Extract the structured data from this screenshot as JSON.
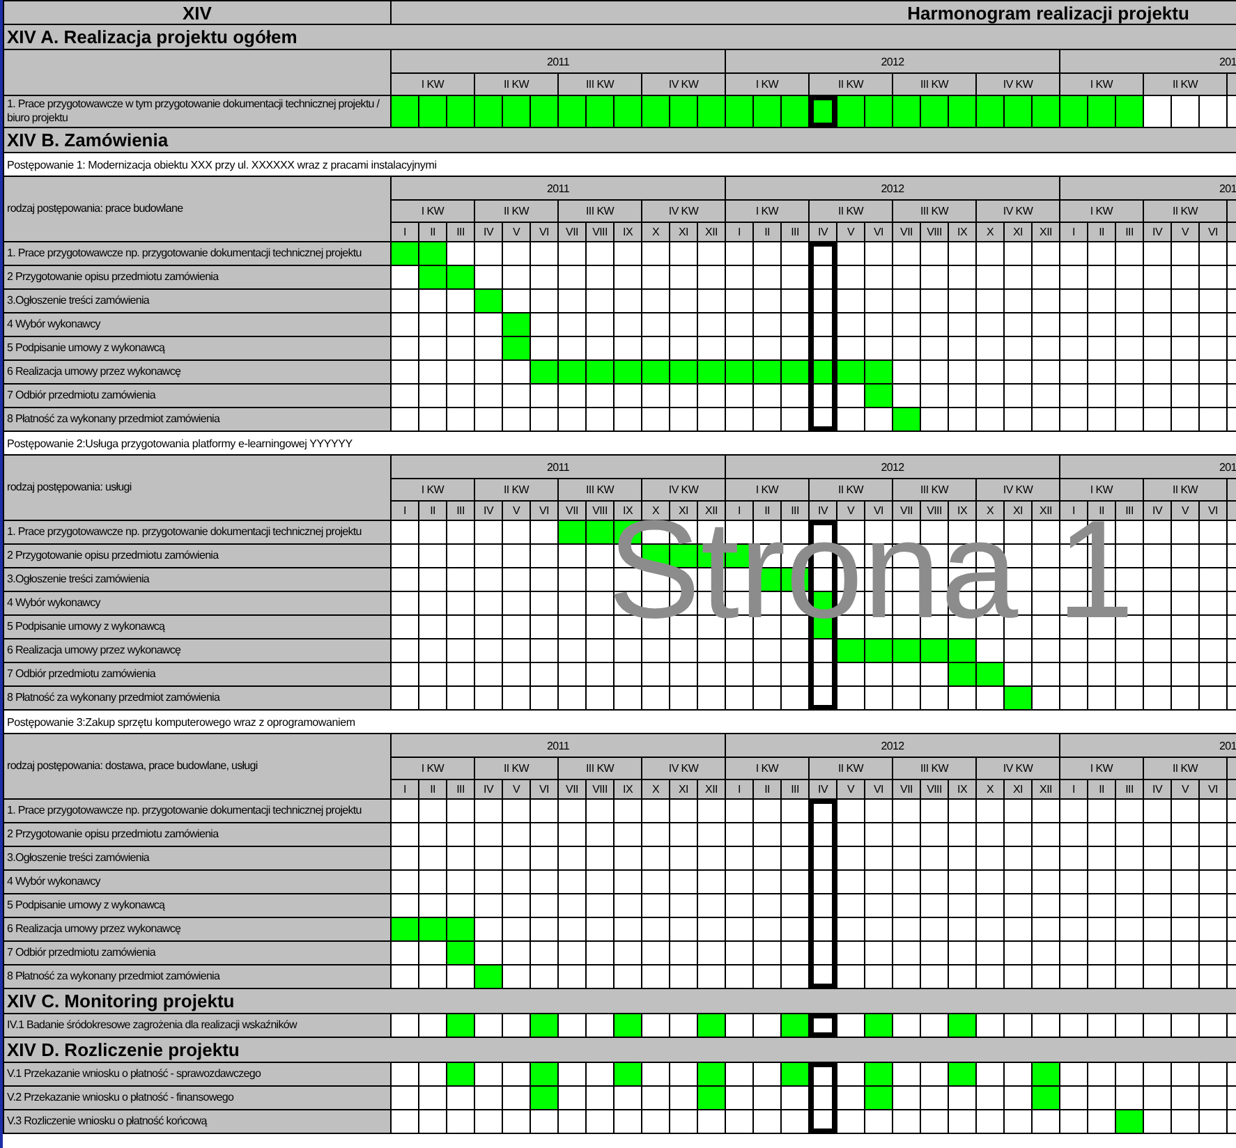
{
  "title_row": {
    "left": "XIV",
    "right": "Harmonogram realizacji projektu"
  },
  "sections": [
    {
      "kind": "overall",
      "title": "XIV A. Realizacja projektu ogółem",
      "timeline": [
        {
          "year": "2011",
          "quarters": [
            {
              "label": "I KW"
            },
            {
              "label": "II KW"
            },
            {
              "label": "III KW"
            },
            {
              "label": "IV KW"
            }
          ]
        },
        {
          "year": "2012",
          "quarters": [
            {
              "label": "I KW"
            },
            {
              "label": "II KW"
            },
            {
              "label": "III KW"
            },
            {
              "label": "IV KW"
            }
          ]
        },
        {
          "year": "201",
          "quarters": [
            {
              "label": "I KW"
            },
            {
              "label": "II KW"
            }
          ]
        }
      ],
      "marked": [
        false,
        false,
        false,
        false,
        false,
        false,
        false,
        false,
        false,
        false,
        false,
        false,
        false,
        false,
        false,
        true,
        false,
        false,
        false,
        false,
        false,
        false,
        false,
        false,
        false,
        false,
        false,
        false,
        false,
        false
      ],
      "rows": [
        {
          "label": "1. Prace przygotowawcze w tym przygotowanie dokumentacji technicznej projektu / biuro projektu",
          "filled": [
            true,
            true,
            true,
            true,
            true,
            true,
            true,
            true,
            true,
            true,
            true,
            true,
            true,
            true,
            true,
            true,
            true,
            true,
            true,
            true,
            true,
            true,
            true,
            true,
            true,
            true,
            true,
            false,
            false,
            false
          ]
        }
      ]
    },
    {
      "kind": "orders",
      "title": "XIV B. Zamówienia",
      "procedures": [
        {
          "name": "Postępowanie 1: Modernizacja obiektu XXX przy ul. XXXXXX wraz z pracami instalacyjnymi",
          "type": "rodzaj postępowania: prace budowlane",
          "timeline": [
            {
              "year": "2011",
              "quarters": [
                {
                  "label": "I KW",
                  "months": [
                    "I",
                    "II",
                    "III"
                  ]
                },
                {
                  "label": "II KW",
                  "months": [
                    "IV",
                    "V",
                    "VI"
                  ]
                },
                {
                  "label": "III KW",
                  "months": [
                    "VII",
                    "VIII",
                    "IX"
                  ]
                },
                {
                  "label": "IV KW",
                  "months": [
                    "X",
                    "XI",
                    "XII"
                  ]
                }
              ]
            },
            {
              "year": "2012",
              "quarters": [
                {
                  "label": "I KW",
                  "months": [
                    "I",
                    "II",
                    "III"
                  ]
                },
                {
                  "label": "II KW",
                  "months": [
                    "IV",
                    "V",
                    "VI"
                  ]
                },
                {
                  "label": "III KW",
                  "months": [
                    "VII",
                    "VIII",
                    "IX"
                  ]
                },
                {
                  "label": "IV KW",
                  "months": [
                    "X",
                    "XI",
                    "XII"
                  ]
                }
              ]
            },
            {
              "year": "201",
              "quarters": [
                {
                  "label": "I KW",
                  "months": [
                    "I",
                    "II",
                    "III"
                  ]
                },
                {
                  "label": "II KW",
                  "months": [
                    "IV",
                    "V",
                    "VI"
                  ]
                }
              ]
            }
          ],
          "marked": [
            false,
            false,
            false,
            false,
            false,
            false,
            false,
            false,
            false,
            false,
            false,
            false,
            false,
            false,
            false,
            true,
            false,
            false,
            false,
            false,
            false,
            false,
            false,
            false,
            false,
            false,
            false,
            false,
            false,
            false
          ],
          "rows": [
            {
              "label": "1. Prace przygotowawcze np. przygotowanie dokumentacji technicznej projektu",
              "filled": [
                true,
                true,
                false,
                false,
                false,
                false,
                false,
                false,
                false,
                false,
                false,
                false,
                false,
                false,
                false,
                false,
                false,
                false,
                false,
                false,
                false,
                false,
                false,
                false,
                false,
                false,
                false,
                false,
                false,
                false
              ]
            },
            {
              "label": "2 Przygotowanie opisu przedmiotu zamówienia",
              "filled": [
                false,
                true,
                true,
                false,
                false,
                false,
                false,
                false,
                false,
                false,
                false,
                false,
                false,
                false,
                false,
                false,
                false,
                false,
                false,
                false,
                false,
                false,
                false,
                false,
                false,
                false,
                false,
                false,
                false,
                false
              ]
            },
            {
              "label": "3.Ogłoszenie treści zamówienia",
              "filled": [
                false,
                false,
                false,
                true,
                false,
                false,
                false,
                false,
                false,
                false,
                false,
                false,
                false,
                false,
                false,
                false,
                false,
                false,
                false,
                false,
                false,
                false,
                false,
                false,
                false,
                false,
                false,
                false,
                false,
                false
              ]
            },
            {
              "label": "4 Wybór wykonawcy",
              "filled": [
                false,
                false,
                false,
                false,
                true,
                false,
                false,
                false,
                false,
                false,
                false,
                false,
                false,
                false,
                false,
                false,
                false,
                false,
                false,
                false,
                false,
                false,
                false,
                false,
                false,
                false,
                false,
                false,
                false,
                false
              ]
            },
            {
              "label": "5 Podpisanie umowy z wykonawcą",
              "filled": [
                false,
                false,
                false,
                false,
                true,
                false,
                false,
                false,
                false,
                false,
                false,
                false,
                false,
                false,
                false,
                false,
                false,
                false,
                false,
                false,
                false,
                false,
                false,
                false,
                false,
                false,
                false,
                false,
                false,
                false
              ]
            },
            {
              "label": "6 Realizacja umowy przez wykonawcę",
              "filled": [
                false,
                false,
                false,
                false,
                false,
                true,
                true,
                true,
                true,
                true,
                true,
                true,
                true,
                true,
                true,
                true,
                true,
                true,
                false,
                false,
                false,
                false,
                false,
                false,
                false,
                false,
                false,
                false,
                false,
                false
              ]
            },
            {
              "label": "7 Odbiór przedmiotu zamówienia",
              "filled": [
                false,
                false,
                false,
                false,
                false,
                false,
                false,
                false,
                false,
                false,
                false,
                false,
                false,
                false,
                false,
                false,
                false,
                true,
                false,
                false,
                false,
                false,
                false,
                false,
                false,
                false,
                false,
                false,
                false,
                false
              ]
            },
            {
              "label": "8 Płatność za wykonany przedmiot zamówienia",
              "filled": [
                false,
                false,
                false,
                false,
                false,
                false,
                false,
                false,
                false,
                false,
                false,
                false,
                false,
                false,
                false,
                false,
                false,
                false,
                true,
                false,
                false,
                false,
                false,
                false,
                false,
                false,
                false,
                false,
                false,
                false
              ]
            }
          ]
        },
        {
          "name": "Postępowanie 2:Usługa przygotowania platformy e-learningowej YYYYYY",
          "type": "rodzaj postępowania: usługi",
          "timeline": [
            {
              "year": "2011",
              "quarters": [
                {
                  "label": "I KW",
                  "months": [
                    "I",
                    "II",
                    "III"
                  ]
                },
                {
                  "label": "II KW",
                  "months": [
                    "IV",
                    "V",
                    "VI"
                  ]
                },
                {
                  "label": "III KW",
                  "months": [
                    "VII",
                    "VIII",
                    "IX"
                  ]
                },
                {
                  "label": "IV KW",
                  "months": [
                    "X",
                    "XI",
                    "XII"
                  ]
                }
              ]
            },
            {
              "year": "2012",
              "quarters": [
                {
                  "label": "I KW",
                  "months": [
                    "I",
                    "II",
                    "III"
                  ]
                },
                {
                  "label": "II KW",
                  "months": [
                    "IV",
                    "V",
                    "VI"
                  ]
                },
                {
                  "label": "III KW",
                  "months": [
                    "VII",
                    "VIII",
                    "IX"
                  ]
                },
                {
                  "label": "IV KW",
                  "months": [
                    "X",
                    "XI",
                    "XII"
                  ]
                }
              ]
            },
            {
              "year": "201",
              "quarters": [
                {
                  "label": "I KW",
                  "months": [
                    "I",
                    "II",
                    "III"
                  ]
                },
                {
                  "label": "II KW",
                  "months": [
                    "IV",
                    "V",
                    "VI"
                  ]
                }
              ]
            }
          ],
          "marked": [
            false,
            false,
            false,
            false,
            false,
            false,
            false,
            false,
            false,
            false,
            false,
            false,
            false,
            false,
            false,
            true,
            false,
            false,
            false,
            false,
            false,
            false,
            false,
            false,
            false,
            false,
            false,
            false,
            false,
            false
          ],
          "rows": [
            {
              "label": "1. Prace przygotowawcze np. przygotowanie dokumentacji technicznej projektu",
              "filled": [
                false,
                false,
                false,
                false,
                false,
                false,
                true,
                true,
                true,
                false,
                false,
                false,
                false,
                false,
                false,
                false,
                false,
                false,
                false,
                false,
                false,
                false,
                false,
                false,
                false,
                false,
                false,
                false,
                false,
                false
              ]
            },
            {
              "label": "2 Przygotowanie opisu przedmiotu zamówienia",
              "filled": [
                false,
                false,
                false,
                false,
                false,
                false,
                false,
                false,
                false,
                true,
                true,
                true,
                true,
                false,
                false,
                false,
                false,
                false,
                false,
                false,
                false,
                false,
                false,
                false,
                false,
                false,
                false,
                false,
                false,
                false
              ]
            },
            {
              "label": "3.Ogłoszenie treści zamówienia",
              "filled": [
                false,
                false,
                false,
                false,
                false,
                false,
                false,
                false,
                false,
                false,
                false,
                false,
                false,
                true,
                true,
                false,
                false,
                false,
                false,
                false,
                false,
                false,
                false,
                false,
                false,
                false,
                false,
                false,
                false,
                false
              ]
            },
            {
              "label": "4 Wybór wykonawcy",
              "filled": [
                false,
                false,
                false,
                false,
                false,
                false,
                false,
                false,
                false,
                false,
                false,
                false,
                false,
                false,
                false,
                true,
                false,
                false,
                false,
                false,
                false,
                false,
                false,
                false,
                false,
                false,
                false,
                false,
                false,
                false
              ]
            },
            {
              "label": "5 Podpisanie umowy z wykonawcą",
              "filled": [
                false,
                false,
                false,
                false,
                false,
                false,
                false,
                false,
                false,
                false,
                false,
                false,
                false,
                false,
                false,
                true,
                false,
                false,
                false,
                false,
                false,
                false,
                false,
                false,
                false,
                false,
                false,
                false,
                false,
                false
              ]
            },
            {
              "label": "6 Realizacja umowy przez wykonawcę",
              "filled": [
                false,
                false,
                false,
                false,
                false,
                false,
                false,
                false,
                false,
                false,
                false,
                false,
                false,
                false,
                false,
                false,
                true,
                true,
                true,
                true,
                true,
                false,
                false,
                false,
                false,
                false,
                false,
                false,
                false,
                false
              ]
            },
            {
              "label": "7 Odbiór przedmiotu zamówienia",
              "filled": [
                false,
                false,
                false,
                false,
                false,
                false,
                false,
                false,
                false,
                false,
                false,
                false,
                false,
                false,
                false,
                false,
                false,
                false,
                false,
                false,
                true,
                true,
                false,
                false,
                false,
                false,
                false,
                false,
                false,
                false
              ]
            },
            {
              "label": "8 Płatność za wykonany przedmiot zamówienia",
              "filled": [
                false,
                false,
                false,
                false,
                false,
                false,
                false,
                false,
                false,
                false,
                false,
                false,
                false,
                false,
                false,
                false,
                false,
                false,
                false,
                false,
                false,
                false,
                true,
                false,
                false,
                false,
                false,
                false,
                false,
                false
              ]
            }
          ]
        },
        {
          "name": "Postępowanie 3:Zakup sprzętu komputerowego wraz z oprogramowaniem",
          "type": "rodzaj postępowania: dostawa, prace budowlane, usługi",
          "timeline": [
            {
              "year": "2011",
              "quarters": [
                {
                  "label": "I KW",
                  "months": [
                    "I",
                    "II",
                    "III"
                  ]
                },
                {
                  "label": "II KW",
                  "months": [
                    "IV",
                    "V",
                    "VI"
                  ]
                },
                {
                  "label": "III KW",
                  "months": [
                    "VII",
                    "VIII",
                    "IX"
                  ]
                },
                {
                  "label": "IV KW",
                  "months": [
                    "X",
                    "XI",
                    "XII"
                  ]
                }
              ]
            },
            {
              "year": "2012",
              "quarters": [
                {
                  "label": "I KW",
                  "months": [
                    "I",
                    "II",
                    "III"
                  ]
                },
                {
                  "label": "II KW",
                  "months": [
                    "IV",
                    "V",
                    "VI"
                  ]
                },
                {
                  "label": "III KW",
                  "months": [
                    "VII",
                    "VIII",
                    "IX"
                  ]
                },
                {
                  "label": "IV KW",
                  "months": [
                    "X",
                    "XI",
                    "XII"
                  ]
                }
              ]
            },
            {
              "year": "201",
              "quarters": [
                {
                  "label": "I KW",
                  "months": [
                    "I",
                    "II",
                    "III"
                  ]
                },
                {
                  "label": "II KW",
                  "months": [
                    "IV",
                    "V",
                    "VI"
                  ]
                }
              ]
            }
          ],
          "marked": [
            false,
            false,
            false,
            false,
            false,
            false,
            false,
            false,
            false,
            false,
            false,
            false,
            false,
            false,
            false,
            true,
            false,
            false,
            false,
            false,
            false,
            false,
            false,
            false,
            false,
            false,
            false,
            false,
            false,
            false
          ],
          "rows": [
            {
              "label": "1. Prace przygotowawcze np. przygotowanie dokumentacji technicznej projektu",
              "filled": [
                false,
                false,
                false,
                false,
                false,
                false,
                false,
                false,
                false,
                false,
                false,
                false,
                false,
                false,
                false,
                false,
                false,
                false,
                false,
                false,
                false,
                false,
                false,
                false,
                false,
                false,
                false,
                false,
                false,
                false
              ]
            },
            {
              "label": "2 Przygotowanie opisu przedmiotu zamówienia",
              "filled": [
                false,
                false,
                false,
                false,
                false,
                false,
                false,
                false,
                false,
                false,
                false,
                false,
                false,
                false,
                false,
                false,
                false,
                false,
                false,
                false,
                false,
                false,
                false,
                false,
                false,
                false,
                false,
                false,
                false,
                false
              ]
            },
            {
              "label": "3.Ogłoszenie treści zamówienia",
              "filled": [
                false,
                false,
                false,
                false,
                false,
                false,
                false,
                false,
                false,
                false,
                false,
                false,
                false,
                false,
                false,
                false,
                false,
                false,
                false,
                false,
                false,
                false,
                false,
                false,
                false,
                false,
                false,
                false,
                false,
                false
              ]
            },
            {
              "label": "4 Wybór wykonawcy",
              "filled": [
                false,
                false,
                false,
                false,
                false,
                false,
                false,
                false,
                false,
                false,
                false,
                false,
                false,
                false,
                false,
                false,
                false,
                false,
                false,
                false,
                false,
                false,
                false,
                false,
                false,
                false,
                false,
                false,
                false,
                false
              ]
            },
            {
              "label": "5 Podpisanie umowy z wykonawcą",
              "filled": [
                false,
                false,
                false,
                false,
                false,
                false,
                false,
                false,
                false,
                false,
                false,
                false,
                false,
                false,
                false,
                false,
                false,
                false,
                false,
                false,
                false,
                false,
                false,
                false,
                false,
                false,
                false,
                false,
                false,
                false
              ]
            },
            {
              "label": "6 Realizacja umowy przez wykonawcę",
              "filled": [
                true,
                true,
                true,
                false,
                false,
                false,
                false,
                false,
                false,
                false,
                false,
                false,
                false,
                false,
                false,
                false,
                false,
                false,
                false,
                false,
                false,
                false,
                false,
                false,
                false,
                false,
                false,
                false,
                false,
                false
              ]
            },
            {
              "label": "7 Odbiór przedmiotu zamówienia",
              "filled": [
                false,
                false,
                true,
                false,
                false,
                false,
                false,
                false,
                false,
                false,
                false,
                false,
                false,
                false,
                false,
                false,
                false,
                false,
                false,
                false,
                false,
                false,
                false,
                false,
                false,
                false,
                false,
                false,
                false,
                false
              ]
            },
            {
              "label": "8 Płatność za wykonany przedmiot zamówienia",
              "filled": [
                false,
                false,
                false,
                true,
                false,
                false,
                false,
                false,
                false,
                false,
                false,
                false,
                false,
                false,
                false,
                false,
                false,
                false,
                false,
                false,
                false,
                false,
                false,
                false,
                false,
                false,
                false,
                false,
                false,
                false
              ]
            }
          ]
        }
      ]
    },
    {
      "kind": "monitoring",
      "title": "XIV C. Monitoring projektu",
      "marked": [
        false,
        false,
        false,
        false,
        false,
        false,
        false,
        false,
        false,
        false,
        false,
        false,
        false,
        false,
        false,
        true,
        false,
        false,
        false,
        false,
        false,
        false,
        false,
        false,
        false,
        false,
        false,
        false,
        false,
        false
      ],
      "rows": [
        {
          "label": "IV.1 Badanie śródokresowe zagrożenia dla realizacji wskaźników",
          "filled": [
            false,
            false,
            true,
            false,
            false,
            true,
            false,
            false,
            true,
            false,
            false,
            true,
            false,
            false,
            true,
            false,
            false,
            true,
            false,
            false,
            true,
            false,
            false,
            false,
            false,
            false,
            false,
            false,
            false,
            false
          ]
        }
      ]
    },
    {
      "kind": "settlement",
      "title": "XIV D. Rozliczenie projektu",
      "marked": [
        false,
        false,
        false,
        false,
        false,
        false,
        false,
        false,
        false,
        false,
        false,
        false,
        false,
        false,
        false,
        true,
        false,
        false,
        false,
        false,
        false,
        false,
        false,
        false,
        false,
        false,
        false,
        false,
        false,
        false
      ],
      "rows": [
        {
          "label": "V.1 Przekazanie wniosku o płatność - sprawozdawczego",
          "filled": [
            false,
            false,
            true,
            false,
            false,
            true,
            false,
            false,
            true,
            false,
            false,
            true,
            false,
            false,
            true,
            false,
            false,
            true,
            false,
            false,
            true,
            false,
            false,
            true,
            false,
            false,
            false,
            false,
            false,
            false
          ]
        },
        {
          "label": "V.2 Przekazanie wniosku o płatność - finansowego",
          "filled": [
            false,
            false,
            false,
            false,
            false,
            true,
            false,
            false,
            false,
            false,
            false,
            true,
            false,
            false,
            false,
            false,
            false,
            true,
            false,
            false,
            false,
            false,
            false,
            true,
            false,
            false,
            false,
            false,
            false,
            false
          ]
        },
        {
          "label": "V.3 Rozliczenie wniosku o płatność końcową",
          "filled": [
            false,
            false,
            false,
            false,
            false,
            false,
            false,
            false,
            false,
            false,
            false,
            false,
            false,
            false,
            false,
            false,
            false,
            false,
            false,
            false,
            false,
            false,
            false,
            false,
            false,
            false,
            true,
            false,
            false,
            false
          ]
        }
      ]
    }
  ],
  "page_label": "Strona 1"
}
